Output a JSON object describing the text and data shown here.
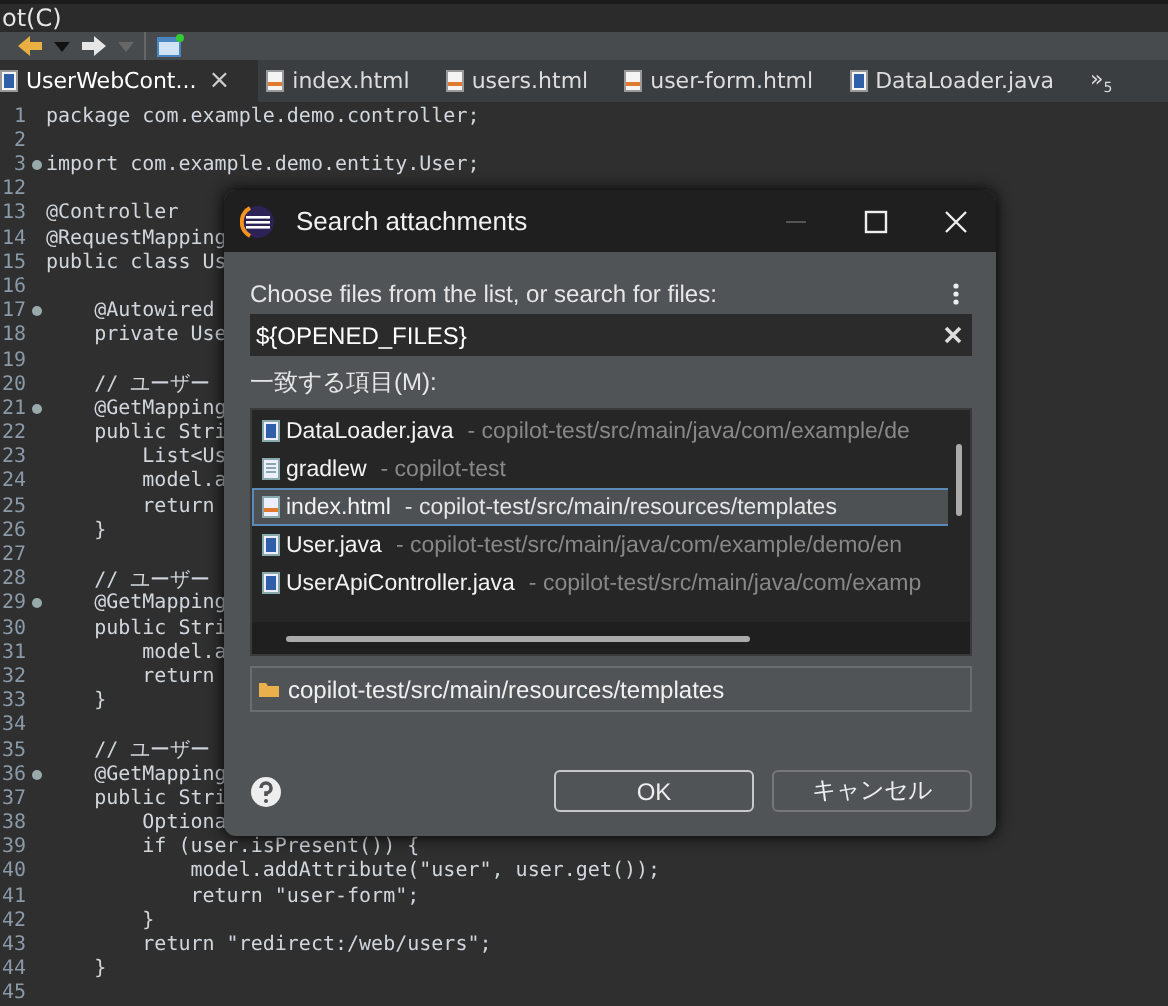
{
  "menu_bar": {
    "items": [
      "ot(C)"
    ]
  },
  "editor_tabs": [
    {
      "label": "UserWebCont...",
      "selected": true,
      "kind": "java",
      "close_symbol": "×"
    },
    {
      "label": "index.html",
      "selected": false,
      "kind": "html"
    },
    {
      "label": "users.html",
      "selected": false,
      "kind": "html"
    },
    {
      "label": "user-form.html",
      "selected": false,
      "kind": "html"
    },
    {
      "label": "DataLoader.java",
      "selected": false,
      "kind": "java"
    }
  ],
  "tab_overflow": {
    "symbol": "»",
    "count": "5"
  },
  "code_lines": [
    {
      "number": "1",
      "text": "package com.example.demo.controller;",
      "marker": false
    },
    {
      "number": "2",
      "marker": false
    },
    {
      "number": "3",
      "text": "import com.example.demo.entity.User;",
      "marker": true
    },
    {
      "number": "12",
      "marker": false
    },
    {
      "number": "13",
      "text": "@Controller",
      "marker": false
    },
    {
      "number": "14",
      "text": "@RequestMapping",
      "marker": false
    },
    {
      "number": "15",
      "text": "public class Us",
      "marker": false
    },
    {
      "number": "16",
      "marker": false
    },
    {
      "number": "17",
      "text": "    @Autowired",
      "marker": true
    },
    {
      "number": "18",
      "text": "    private Use",
      "marker": false
    },
    {
      "number": "19",
      "marker": false
    },
    {
      "number": "20",
      "text": "    // ユーザー",
      "marker": false
    },
    {
      "number": "21",
      "text": "    @GetMapping",
      "marker": true
    },
    {
      "number": "22",
      "text": "    public Stri",
      "marker": false
    },
    {
      "number": "23",
      "text": "        List<Us",
      "marker": false
    },
    {
      "number": "24",
      "text": "        model.a",
      "marker": false
    },
    {
      "number": "25",
      "text": "        return",
      "marker": false
    },
    {
      "number": "26",
      "text": "    }",
      "marker": false
    },
    {
      "number": "27",
      "marker": false
    },
    {
      "number": "28",
      "text": "    // ユーザー",
      "marker": false
    },
    {
      "number": "29",
      "text": "    @GetMapping",
      "marker": true
    },
    {
      "number": "30",
      "text": "    public Stri",
      "marker": false
    },
    {
      "number": "31",
      "text": "        model.a",
      "marker": false
    },
    {
      "number": "32",
      "text": "        return",
      "marker": false
    },
    {
      "number": "33",
      "text": "    }",
      "marker": false
    },
    {
      "number": "34",
      "marker": false
    },
    {
      "number": "35",
      "text": "    // ユーザー",
      "marker": false
    },
    {
      "number": "36",
      "text": "    @GetMapping",
      "marker": true
    },
    {
      "number": "37",
      "text": "    public Stri",
      "marker": false
    },
    {
      "number": "38",
      "text": "        Optiona",
      "marker": false
    },
    {
      "number": "39",
      "text": "        if (user.isPresent()) {",
      "marker": false
    },
    {
      "number": "40",
      "text": "            model.addAttribute(\"user\", user.get());",
      "marker": false
    },
    {
      "number": "41",
      "text": "            return \"user-form\";",
      "marker": false
    },
    {
      "number": "42",
      "text": "        }",
      "marker": false
    },
    {
      "number": "43",
      "text": "        return \"redirect:/web/users\";",
      "marker": false
    },
    {
      "number": "44",
      "text": "    }",
      "marker": false
    },
    {
      "number": "45",
      "marker": false
    }
  ],
  "dialog": {
    "title": "Search attachments",
    "prompt": "Choose files from the list, or search for files:",
    "search": {
      "value": "${OPENED_FILES}"
    },
    "list_label": "一致する項目(M):",
    "items": [
      {
        "name": "DataLoader.java",
        "path": "- copilot-test/src/main/java/com/example/de",
        "kind": "java",
        "selected": false
      },
      {
        "name": "gradlew",
        "path": "- copilot-test",
        "kind": "file",
        "selected": false
      },
      {
        "name": "index.html",
        "path": "- copilot-test/src/main/resources/templates",
        "kind": "html",
        "selected": true
      },
      {
        "name": "User.java",
        "path": "- copilot-test/src/main/java/com/example/demo/en",
        "kind": "java",
        "selected": false
      },
      {
        "name": "UserApiController.java",
        "path": "- copilot-test/src/main/java/com/examp",
        "kind": "java",
        "selected": false
      }
    ],
    "location": "copilot-test/src/main/resources/templates",
    "buttons": [
      {
        "label": "OK",
        "kind": "default"
      },
      {
        "label": "キャンセル",
        "kind": "normal"
      }
    ]
  }
}
